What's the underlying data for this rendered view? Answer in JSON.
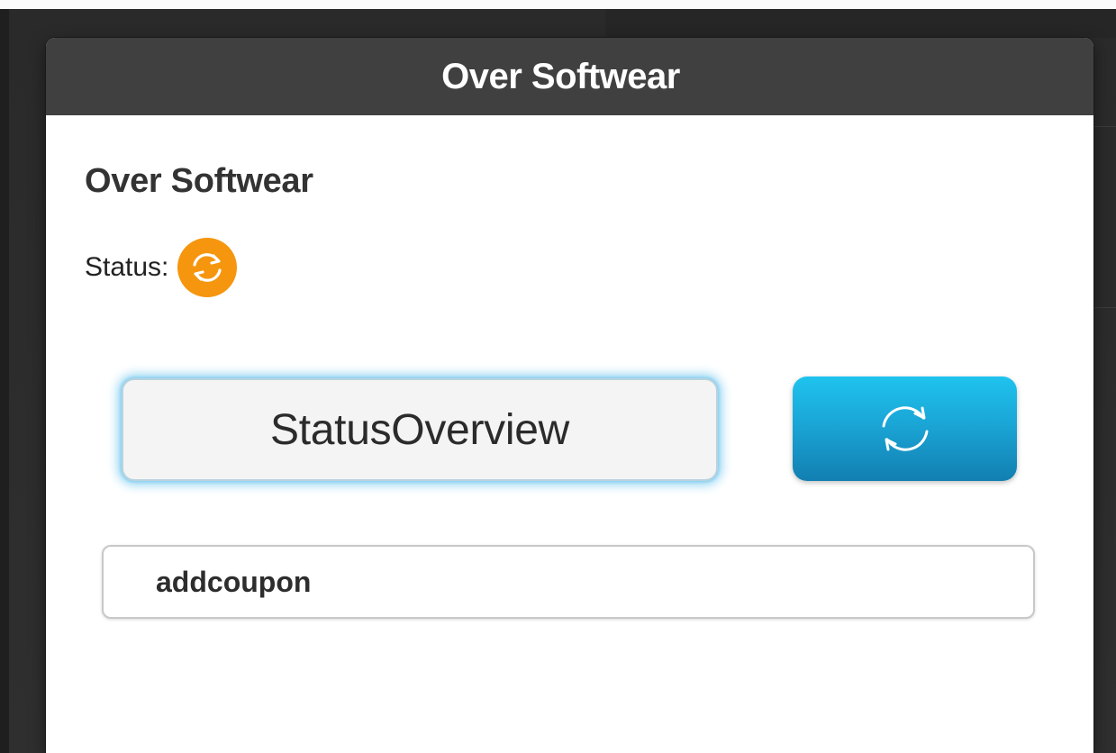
{
  "window": {
    "title": "Over Softwear"
  },
  "page": {
    "heading": "Over Softwear",
    "status_label": "Status:",
    "status_icon": "sync-icon",
    "status_color": "#f5960e"
  },
  "actions": {
    "overview_label": "StatusOverview",
    "refresh_icon": "refresh-icon",
    "refresh_color": "#1aa6d6"
  },
  "coupon": {
    "value": "addcoupon"
  }
}
